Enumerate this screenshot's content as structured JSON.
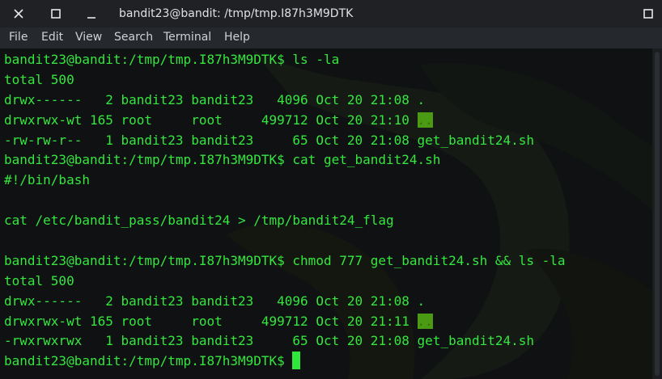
{
  "window": {
    "title": "bandit23@bandit: /tmp/tmp.I87h3M9DTK"
  },
  "menu": {
    "items": [
      "File",
      "Edit",
      "View",
      "Search",
      "Terminal",
      "Help"
    ]
  },
  "terminal": {
    "lines": [
      "bandit23@bandit:/tmp/tmp.I87h3M9DTK$ ls -la",
      "total 500",
      "drwx------   2 bandit23 bandit23   4096 Oct 20 21:08 .",
      "drwxrwx-wt 165 root     root     499712 Oct 20 21:10 ",
      "-rw-rw-r--   1 bandit23 bandit23     65 Oct 20 21:08 get_bandit24.sh",
      "bandit23@bandit:/tmp/tmp.I87h3M9DTK$ cat get_bandit24.sh",
      "#!/bin/bash",
      "",
      "cat /etc/bandit_pass/bandit24 > /tmp/bandit24_flag",
      "",
      "bandit23@bandit:/tmp/tmp.I87h3M9DTK$ chmod 777 get_bandit24.sh && ls -la",
      "total 500",
      "drwx------   2 bandit23 bandit23   4096 Oct 20 21:08 .",
      "drwxrwx-wt 165 root     root     499712 Oct 20 21:11 ",
      "-rwxrwxrwx   1 bandit23 bandit23     65 Oct 20 21:08 get_bandit24.sh",
      "bandit23@bandit:/tmp/tmp.I87h3M9DTK$ "
    ],
    "highlight_text": ".."
  },
  "colors": {
    "text": "#35e63f",
    "highlight_bg": "#4b9a14",
    "cursor": "#2ee93a",
    "terminal_bg": "#0f1112"
  }
}
